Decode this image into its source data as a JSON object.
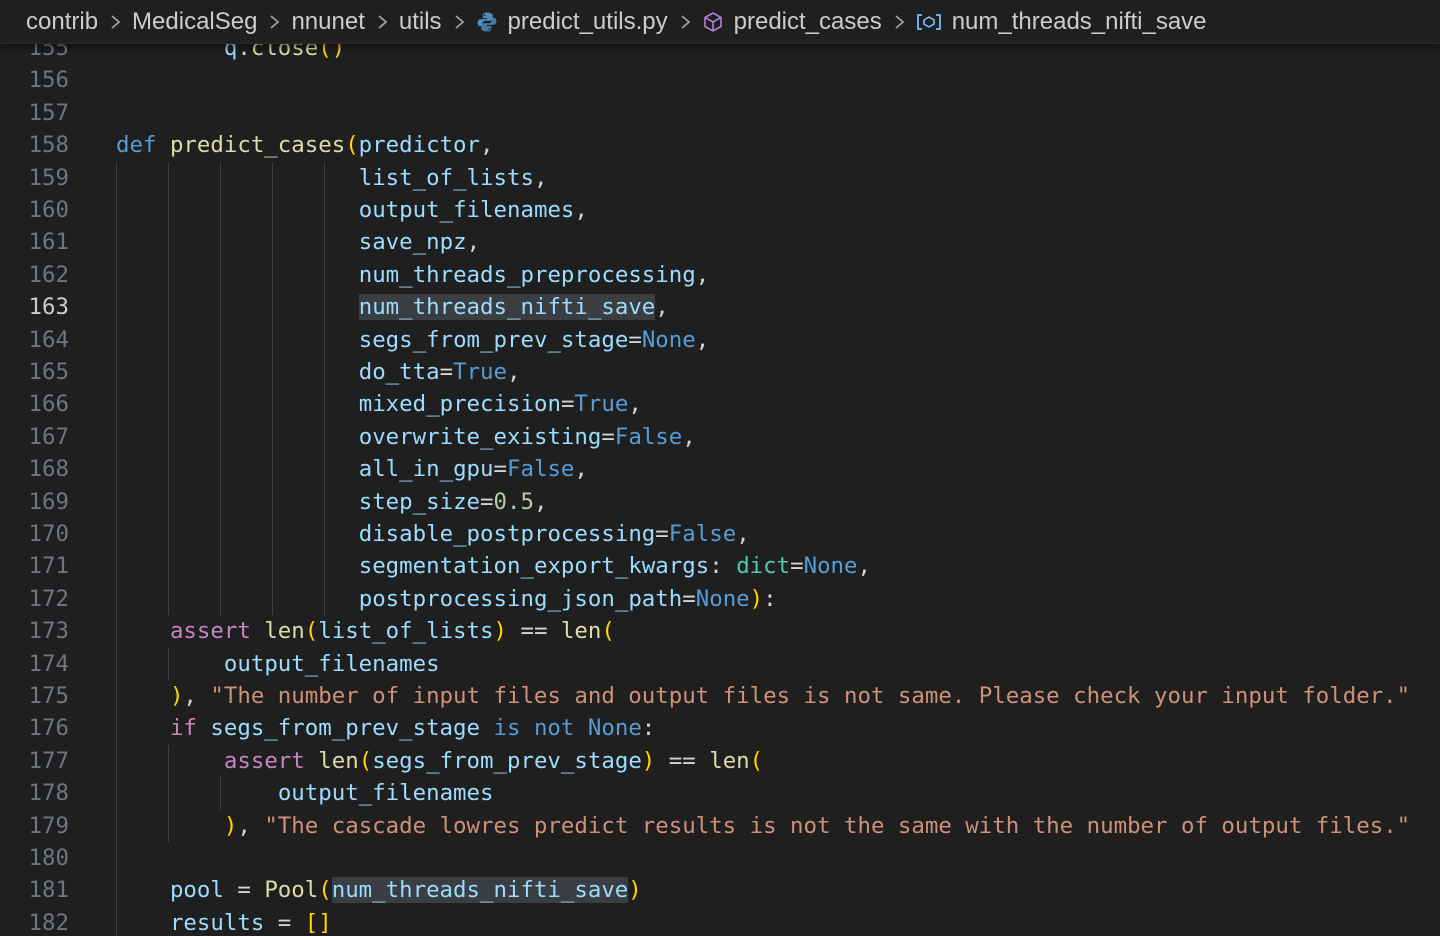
{
  "breadcrumb": {
    "items": [
      "contrib",
      "MedicalSeg",
      "nnunet",
      "utils",
      "predict_utils.py",
      "predict_cases",
      "num_threads_nifti_save"
    ],
    "icons": [
      "python-icon",
      "method-cube-icon",
      "variable-icon"
    ]
  },
  "editor": {
    "active_line": "163",
    "lines": [
      {
        "n": "155",
        "code": "        q.close()"
      },
      {
        "n": "156",
        "code": ""
      },
      {
        "n": "157",
        "code": ""
      },
      {
        "n": "158",
        "code": "def predict_cases(predictor,"
      },
      {
        "n": "159",
        "code": "                  list_of_lists,"
      },
      {
        "n": "160",
        "code": "                  output_filenames,"
      },
      {
        "n": "161",
        "code": "                  save_npz,"
      },
      {
        "n": "162",
        "code": "                  num_threads_preprocessing,"
      },
      {
        "n": "163",
        "code": "                  num_threads_nifti_save,"
      },
      {
        "n": "164",
        "code": "                  segs_from_prev_stage=None,"
      },
      {
        "n": "165",
        "code": "                  do_tta=True,"
      },
      {
        "n": "166",
        "code": "                  mixed_precision=True,"
      },
      {
        "n": "167",
        "code": "                  overwrite_existing=False,"
      },
      {
        "n": "168",
        "code": "                  all_in_gpu=False,"
      },
      {
        "n": "169",
        "code": "                  step_size=0.5,"
      },
      {
        "n": "170",
        "code": "                  disable_postprocessing=False,"
      },
      {
        "n": "171",
        "code": "                  segmentation_export_kwargs: dict=None,"
      },
      {
        "n": "172",
        "code": "                  postprocessing_json_path=None):"
      },
      {
        "n": "173",
        "code": "    assert len(list_of_lists) == len("
      },
      {
        "n": "174",
        "code": "        output_filenames"
      },
      {
        "n": "175",
        "code": "    ), \"The number of input files and output files is not same. Please check your input folder.\""
      },
      {
        "n": "176",
        "code": "    if segs_from_prev_stage is not None:"
      },
      {
        "n": "177",
        "code": "        assert len(segs_from_prev_stage) == len("
      },
      {
        "n": "178",
        "code": "            output_filenames"
      },
      {
        "n": "179",
        "code": "        ), \"The cascade lowres predict results is not the same with the number of output files.\""
      },
      {
        "n": "180",
        "code": ""
      },
      {
        "n": "181",
        "code": "    pool = Pool(num_threads_nifti_save)"
      },
      {
        "n": "182",
        "code": "    results = []"
      }
    ]
  },
  "colors": {
    "background": "#1f1f1f",
    "keyword": "#569cd6",
    "control": "#c586c0",
    "function": "#dcdcaa",
    "parameter": "#9cdcfe",
    "string": "#ce9178",
    "number": "#b5cea8",
    "class": "#4ec9b0",
    "bracket_gold": "#ffd700",
    "bracket_orchid": "#da70d6",
    "selection_highlight": "#3a3d41"
  }
}
